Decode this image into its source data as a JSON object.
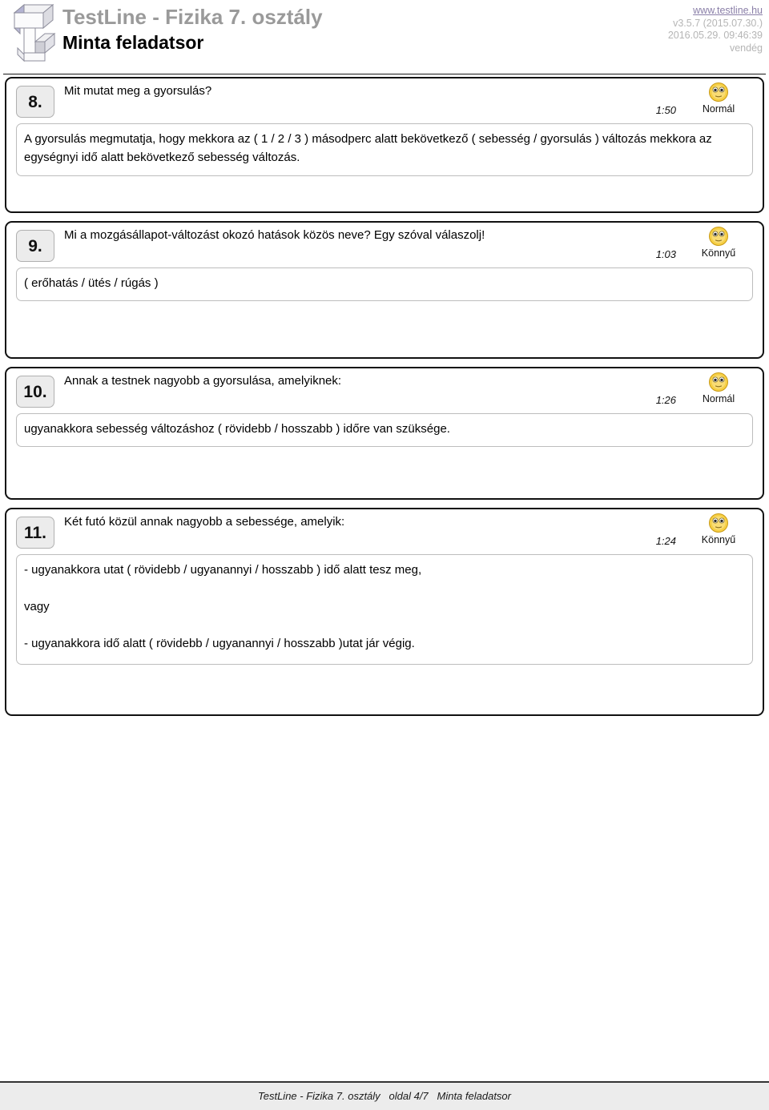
{
  "header": {
    "logo_icon": "testline-3d-t-logo",
    "title": "TestLine - Fizika 7. osztály",
    "subtitle": "Minta feladatsor",
    "url": "www.testline.hu",
    "version": "v3.5.7 (2015.07.30.)",
    "timestamp": "2016.05.29. 09:46:39",
    "user": "vendég"
  },
  "questions": [
    {
      "number": "8.",
      "title": "Mit mutat meg a gyorsulás?",
      "time": "1:50",
      "difficulty": "Normál",
      "difficulty_icon": "smiley-face-icon",
      "answer_lines": [
        "A gyorsulás megmutatja, hogy mekkora az ( 1 / 2 / 3 ) másodperc alatt bekövetkező ( sebesség / gyorsulás ) változás mekkora az egységnyi idő alatt bekövetkező sebesség változás."
      ]
    },
    {
      "number": "9.",
      "title": "Mi a mozgásállapot-változást okozó hatások közös neve? Egy szóval válaszolj!",
      "time": "1:03",
      "difficulty": "Könnyű",
      "difficulty_icon": "smiley-face-icon",
      "answer_lines": [
        "( erőhatás / ütés / rúgás )"
      ]
    },
    {
      "number": "10.",
      "title": "Annak a testnek nagyobb a gyorsulása, amelyiknek:",
      "time": "1:26",
      "difficulty": "Normál",
      "difficulty_icon": "smiley-face-icon",
      "answer_lines": [
        "ugyanakkora sebesség változáshoz ( rövidebb / hosszabb ) időre van szüksége."
      ]
    },
    {
      "number": "11.",
      "title": "Két futó közül annak nagyobb a sebessége, amelyik:",
      "time": "1:24",
      "difficulty": "Könnyű",
      "difficulty_icon": "smiley-face-icon",
      "answer_lines": [
        "- ugyanakkora utat ( rövidebb / ugyanannyi / hosszabb ) idő alatt tesz meg,",
        "vagy",
        "- ugyanakkora idő alatt ( rövidebb / ugyanannyi / hosszabb )utat jár végig."
      ]
    }
  ],
  "footer": {
    "text": "TestLine - Fizika 7. osztály   oldal 4/7   Minta feladatsor"
  },
  "colors": {
    "title_gray": "#9a9a9a",
    "meta_gray": "#b5b5b5",
    "link_purple": "#8a7fa8",
    "smiley_yellow": "#f7d249",
    "border_black": "#111111",
    "number_box_gray": "#ececec",
    "footer_gray": "#ececec"
  }
}
